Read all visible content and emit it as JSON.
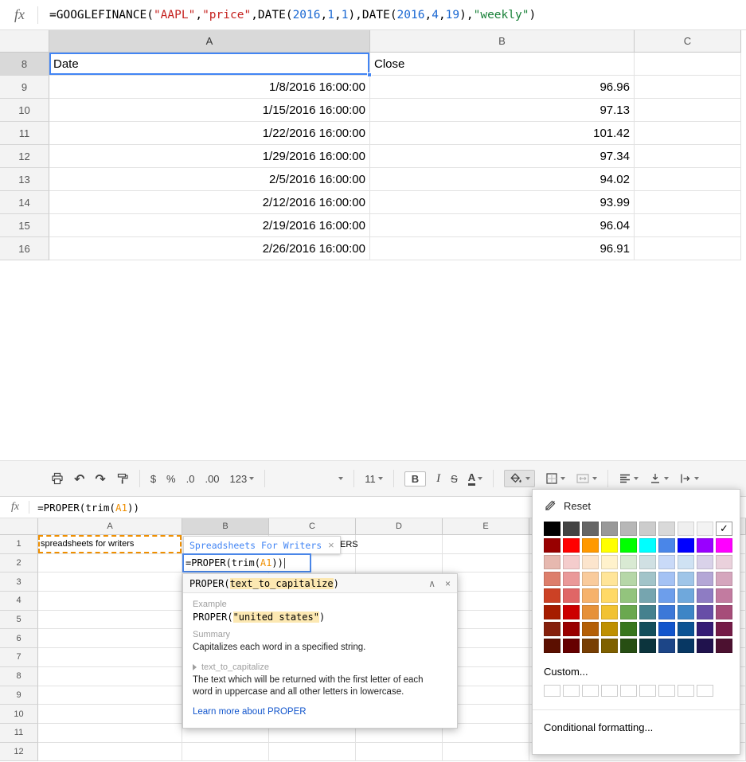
{
  "colors": {
    "accent_blue": "#4285f4",
    "reference_orange": "#ef8f00",
    "string_red": "#c5221f",
    "number_blue": "#1967d2",
    "string_green": "#188038",
    "arg_highlight": "#fce8b2",
    "link_blue": "#1155cc"
  },
  "top_sheet": {
    "formula_bar": {
      "fx_label": "fx",
      "formula_parts": [
        {
          "text": "=GOOGLEFINANCE(",
          "color": "#000000"
        },
        {
          "text": "\"AAPL\"",
          "color": "#c5221f"
        },
        {
          "text": ",",
          "color": "#000000"
        },
        {
          "text": "\"price\"",
          "color": "#c5221f"
        },
        {
          "text": ",DATE(",
          "color": "#000000"
        },
        {
          "text": "2016",
          "color": "#1967d2"
        },
        {
          "text": ",",
          "color": "#000000"
        },
        {
          "text": "1",
          "color": "#1967d2"
        },
        {
          "text": ",",
          "color": "#000000"
        },
        {
          "text": "1",
          "color": "#1967d2"
        },
        {
          "text": "),DATE(",
          "color": "#000000"
        },
        {
          "text": "2016",
          "color": "#1967d2"
        },
        {
          "text": ",",
          "color": "#000000"
        },
        {
          "text": "4",
          "color": "#1967d2"
        },
        {
          "text": ",",
          "color": "#000000"
        },
        {
          "text": "19",
          "color": "#1967d2"
        },
        {
          "text": "),",
          "color": "#000000"
        },
        {
          "text": "\"weekly\"",
          "color": "#188038"
        },
        {
          "text": ")",
          "color": "#000000"
        }
      ]
    },
    "column_headers": [
      "A",
      "B",
      "C"
    ],
    "selected_column": "A",
    "rows": [
      {
        "num": "8",
        "a": "Date",
        "b": "Close",
        "selected": true
      },
      {
        "num": "9",
        "a": "1/8/2016 16:00:00",
        "b": "96.96"
      },
      {
        "num": "10",
        "a": "1/15/2016 16:00:00",
        "b": "97.13"
      },
      {
        "num": "11",
        "a": "1/22/2016 16:00:00",
        "b": "101.42"
      },
      {
        "num": "12",
        "a": "1/29/2016 16:00:00",
        "b": "97.34"
      },
      {
        "num": "13",
        "a": "2/5/2016 16:00:00",
        "b": "94.02"
      },
      {
        "num": "14",
        "a": "2/12/2016 16:00:00",
        "b": "93.99"
      },
      {
        "num": "15",
        "a": "2/19/2016 16:00:00",
        "b": "96.04"
      },
      {
        "num": "16",
        "a": "2/26/2016 16:00:00",
        "b": "96.91"
      }
    ]
  },
  "bottom_sheet": {
    "toolbar": {
      "currency": "$",
      "percent": "%",
      "decimal_decrease": ".0",
      "decimal_increase": ".00",
      "more_formats": "123",
      "font_size": "11",
      "bold": "B",
      "italic": "I",
      "strikethrough": "S",
      "text_color": "A"
    },
    "formula_bar": {
      "fx_label": "fx"
    },
    "formula_parts": [
      {
        "text": "=PROPER(trim(",
        "color": "#000000"
      },
      {
        "text": "A1",
        "color": "#ef8f00"
      },
      {
        "text": "))",
        "color": "#000000"
      }
    ],
    "column_headers": [
      "A",
      "B",
      "C",
      "D",
      "E"
    ],
    "selected_column": "B",
    "row_numbers": [
      "1",
      "2",
      "3",
      "4",
      "5",
      "6",
      "7",
      "8",
      "9",
      "10",
      "11",
      "12"
    ],
    "cells": {
      "a1": "spreadsheets for writers",
      "b1_overflow": "ERS"
    },
    "autocomplete_chip": {
      "text": "Spreadsheets For Writers",
      "close": "×"
    }
  },
  "function_help": {
    "signature_prefix": "PROPER(",
    "signature_arg": "text_to_capitalize",
    "signature_suffix": ")",
    "collapse_icon": "∧",
    "close_icon": "×",
    "example_label": "Example",
    "example_prefix": "PROPER(",
    "example_arg": "\"united states\"",
    "example_suffix": ")",
    "summary_label": "Summary",
    "summary_text": "Capitalizes each word in a specified string.",
    "param_name": "text_to_capitalize",
    "param_desc": "The text which will be returned with the first letter of each word in uppercase and all other letters in lowercase.",
    "link": "Learn more about PROPER"
  },
  "color_picker": {
    "reset_label": "Reset",
    "custom_label": "Custom...",
    "conditional_label": "Conditional formatting...",
    "selected_color": "#ffffff",
    "custom_slots": 9,
    "palette": [
      [
        "#000000",
        "#434343",
        "#666666",
        "#999999",
        "#b7b7b7",
        "#cccccc",
        "#d9d9d9",
        "#efefef",
        "#f3f3f3",
        "#ffffff"
      ],
      [
        "#980000",
        "#ff0000",
        "#ff9900",
        "#ffff00",
        "#00ff00",
        "#00ffff",
        "#4a86e8",
        "#0000ff",
        "#9900ff",
        "#ff00ff"
      ],
      [
        "#e6b8af",
        "#f4cccc",
        "#fce5cd",
        "#fff2cc",
        "#d9ead3",
        "#d0e0e3",
        "#c9daf8",
        "#cfe2f3",
        "#d9d2e9",
        "#ead1dc"
      ],
      [
        "#dd7e6b",
        "#ea9999",
        "#f9cb9c",
        "#ffe599",
        "#b6d7a8",
        "#a2c4c9",
        "#a4c2f4",
        "#9fc5e8",
        "#b4a7d6",
        "#d5a6bd"
      ],
      [
        "#cc4125",
        "#e06666",
        "#f6b26b",
        "#ffd966",
        "#93c47d",
        "#76a5af",
        "#6d9eeb",
        "#6fa8dc",
        "#8e7cc3",
        "#c27ba0"
      ],
      [
        "#a61c00",
        "#cc0000",
        "#e69138",
        "#f1c232",
        "#6aa84f",
        "#45818e",
        "#3c78d8",
        "#3d85c6",
        "#674ea7",
        "#a64d79"
      ],
      [
        "#85200c",
        "#990000",
        "#b45f06",
        "#bf9000",
        "#38761d",
        "#134f5c",
        "#1155cc",
        "#0b5394",
        "#351c75",
        "#741b47"
      ],
      [
        "#5b0f00",
        "#660000",
        "#783f04",
        "#7f6000",
        "#274e13",
        "#0c343d",
        "#1c4587",
        "#073763",
        "#20124d",
        "#4c1130"
      ]
    ]
  }
}
